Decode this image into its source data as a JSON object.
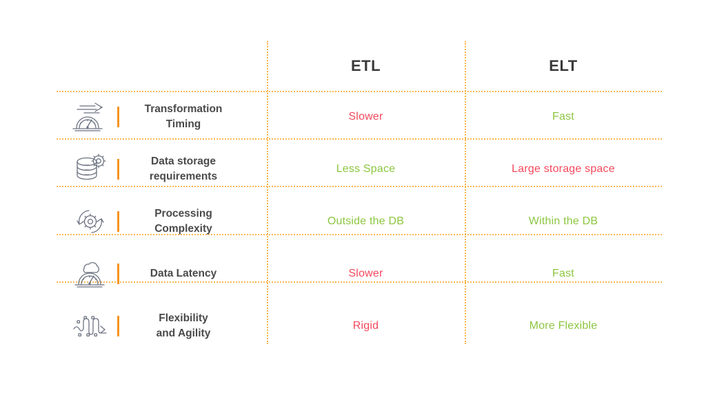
{
  "title": "ETL vs ELT comparison table",
  "colors": {
    "accent_orange": "#F7941E",
    "gridline_orange": "#FBB040",
    "positive_green": "#8CC63F",
    "negative_red": "#F4485C",
    "heading_gray": "#3a3a3a",
    "label_gray": "#4a4a4a",
    "icon_gray": "#6b7280",
    "background": "#FFFFFF"
  },
  "table": {
    "corner_label": "",
    "columns": [
      {
        "id": "criteria",
        "label": ""
      },
      {
        "id": "etl",
        "label": "ETL"
      },
      {
        "id": "elt",
        "label": "ELT"
      }
    ],
    "rows": [
      {
        "icon": "speedometer-arrow-icon",
        "label": "Transformation Timing",
        "label_line1": "Transformation",
        "label_line2": "Timing",
        "etl": {
          "text": "Slower",
          "sentiment": "negative"
        },
        "elt": {
          "text": "Fast",
          "sentiment": "positive"
        }
      },
      {
        "icon": "database-gear-icon",
        "label": "Data storage requirements",
        "label_line1": "Data storage",
        "label_line2": "requirements",
        "etl": {
          "text": "Less Space",
          "sentiment": "positive"
        },
        "elt": {
          "text": "Large storage space",
          "sentiment": "negative"
        }
      },
      {
        "icon": "gear-cycle-icon",
        "label": "Processing Complexity",
        "label_line1": "Processing",
        "label_line2": "Complexity",
        "etl": {
          "text": "Outside the DB",
          "sentiment": "positive"
        },
        "elt": {
          "text": "Within the DB",
          "sentiment": "positive"
        }
      },
      {
        "icon": "gauge-cloud-icon",
        "label": "Data Latency",
        "label_line1": "Data Latency",
        "label_line2": "",
        "etl": {
          "text": "Slower",
          "sentiment": "negative"
        },
        "elt": {
          "text": "Fast",
          "sentiment": "positive"
        }
      },
      {
        "icon": "flexible-path-arrow-icon",
        "label": "Flexibility and Agility",
        "label_line1": "Flexibility",
        "label_line2": "and Agility",
        "etl": {
          "text": "Rigid",
          "sentiment": "negative"
        },
        "elt": {
          "text": "More Flexible",
          "sentiment": "positive"
        }
      }
    ]
  }
}
